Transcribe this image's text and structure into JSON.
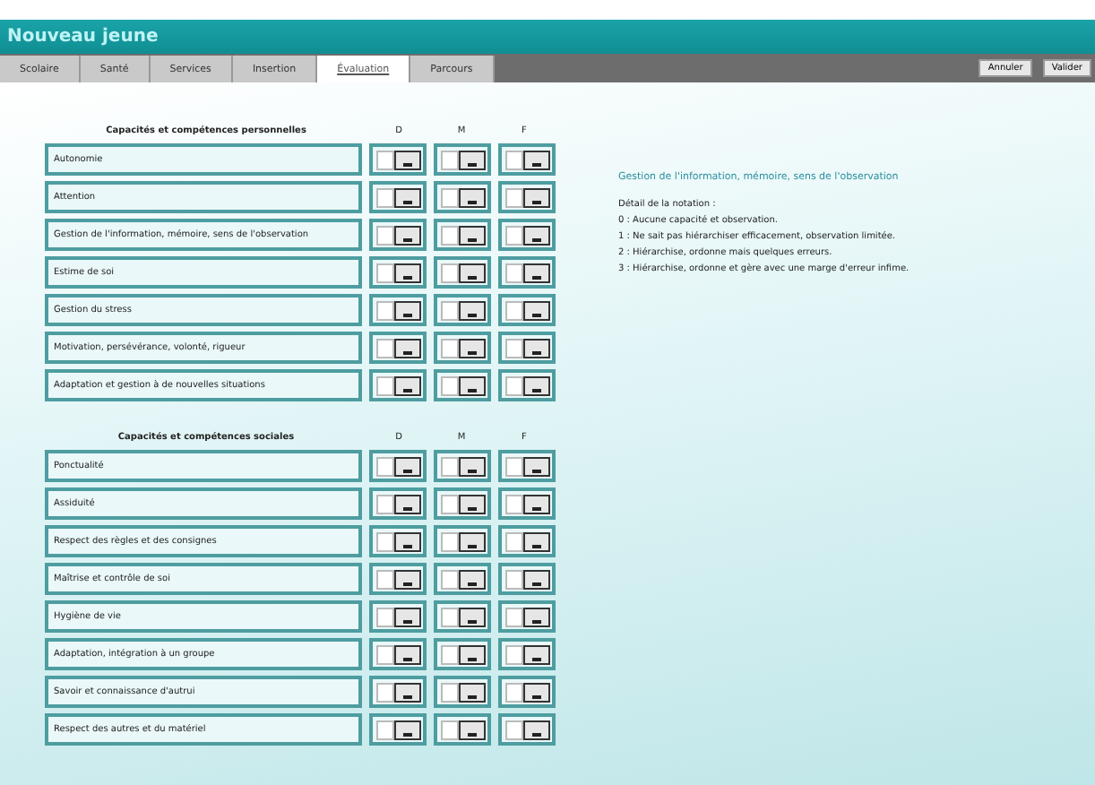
{
  "window": {
    "title": "Nouveau jeune"
  },
  "tabs": [
    {
      "label": "Scolaire",
      "selected": false
    },
    {
      "label": "Santé",
      "selected": false
    },
    {
      "label": "Services",
      "selected": false
    },
    {
      "label": "Insertion",
      "selected": false
    },
    {
      "label": "Évaluation",
      "selected": true
    },
    {
      "label": "Parcours",
      "selected": false
    }
  ],
  "buttons": [
    "Annuler",
    "Valider"
  ],
  "sections": [
    {
      "title": "Capacités et compétences personnelles",
      "columns": [
        "D",
        "M",
        "F"
      ],
      "rows": [
        {
          "label": "Autonomie",
          "ratings": [
            {
              "checked": false
            },
            {
              "checked": false
            },
            {
              "checked": false
            }
          ]
        },
        {
          "label": "Attention",
          "ratings": [
            {
              "checked": false
            },
            {
              "checked": false
            },
            {
              "checked": false
            }
          ]
        },
        {
          "label": "Gestion de l'information, mémoire, sens de l'observation",
          "ratings": [
            {
              "checked": false
            },
            {
              "checked": false
            },
            {
              "checked": false
            }
          ]
        },
        {
          "label": "Estime de soi",
          "ratings": [
            {
              "checked": false
            },
            {
              "checked": false
            },
            {
              "checked": false
            }
          ]
        },
        {
          "label": "Gestion du stress",
          "ratings": [
            {
              "checked": false
            },
            {
              "checked": false
            },
            {
              "checked": false
            }
          ]
        },
        {
          "label": "Motivation, persévérance, volonté, rigueur",
          "ratings": [
            {
              "checked": false
            },
            {
              "checked": false
            },
            {
              "checked": false
            }
          ]
        },
        {
          "label": "Adaptation et gestion à de nouvelles situations",
          "ratings": [
            {
              "checked": false
            },
            {
              "checked": false
            },
            {
              "checked": false
            }
          ]
        }
      ]
    },
    {
      "title": "Capacités et compétences sociales",
      "columns": [
        "D",
        "M",
        "F"
      ],
      "rows": [
        {
          "label": "Ponctualité",
          "ratings": [
            {
              "checked": false
            },
            {
              "checked": false
            },
            {
              "checked": false
            }
          ]
        },
        {
          "label": "Assiduité",
          "ratings": [
            {
              "checked": false
            },
            {
              "checked": false
            },
            {
              "checked": false
            }
          ]
        },
        {
          "label": "Respect des règles et des consignes",
          "ratings": [
            {
              "checked": false
            },
            {
              "checked": false
            },
            {
              "checked": false
            }
          ]
        },
        {
          "label": "Maîtrise et contrôle de soi",
          "ratings": [
            {
              "checked": false
            },
            {
              "checked": false
            },
            {
              "checked": false
            }
          ]
        },
        {
          "label": "Hygiène de vie",
          "ratings": [
            {
              "checked": false
            },
            {
              "checked": false
            },
            {
              "checked": false
            }
          ]
        },
        {
          "label": "Adaptation, intégration à un groupe",
          "ratings": [
            {
              "checked": false
            },
            {
              "checked": false
            },
            {
              "checked": false
            }
          ]
        },
        {
          "label": "Savoir et connaissance d'autrui",
          "ratings": [
            {
              "checked": false
            },
            {
              "checked": false
            },
            {
              "checked": false
            }
          ]
        },
        {
          "label": "Respect des autres et du matériel",
          "ratings": [
            {
              "checked": false
            },
            {
              "checked": false
            },
            {
              "checked": false
            }
          ]
        }
      ]
    }
  ],
  "help": {
    "title": "Gestion de l'information, mémoire, sens de l'observation",
    "subtitle": "Détail de la notation :",
    "lines": [
      "0 : Aucune capacité et observation.",
      "1 : Ne sait pas hiérarchiser efficacement, observation limitée.",
      "2 : Hiérarchise, ordonne mais quelques erreurs.",
      "3 : Hiérarchise, ordonne et gère avec une marge d'erreur infime."
    ]
  }
}
